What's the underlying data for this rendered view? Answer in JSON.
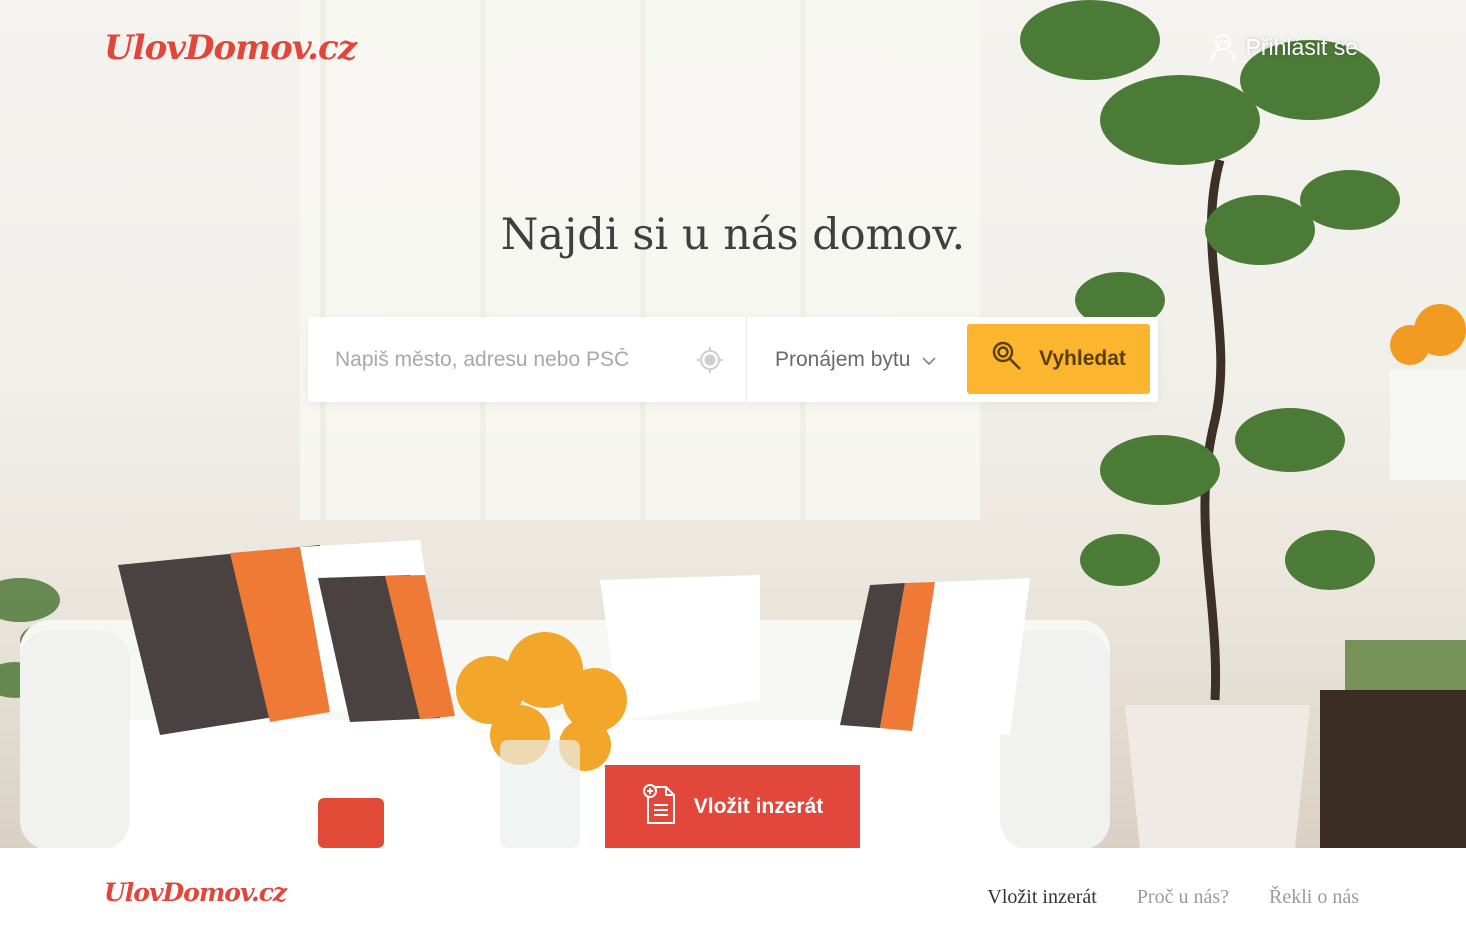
{
  "brand": {
    "name": "UlovDomov.cz"
  },
  "header": {
    "login_label": "Přihlásit se",
    "login_icon": "user-icon"
  },
  "hero": {
    "headline": "Najdi si u nás domov.",
    "search": {
      "placeholder": "Napiš město, adresu nebo PSČ",
      "location_icon": "crosshair-icon",
      "type_selected": "Pronájem bytu",
      "button_label": "Vyhledat",
      "button_icon": "magnifier-icon"
    },
    "post_button": {
      "label": "Vložit inzerát",
      "icon": "document-add-icon"
    }
  },
  "footer": {
    "nav": [
      {
        "label": "Vložit inzerát",
        "active": true
      },
      {
        "label": "Proč u nás?",
        "active": false
      },
      {
        "label": "Řekli o nás",
        "active": false
      }
    ]
  },
  "colors": {
    "brand_red": "#e2463a",
    "search_yellow": "#fcb52e",
    "post_red": "#e2473b"
  }
}
